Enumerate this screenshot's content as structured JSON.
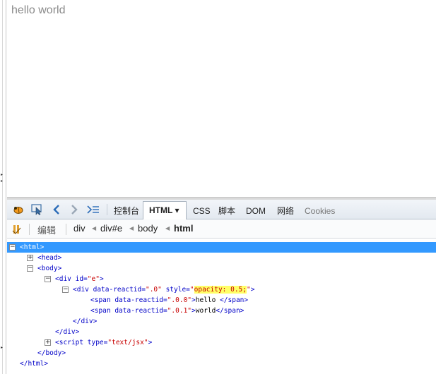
{
  "page": {
    "text": "hello world"
  },
  "toolbar": {
    "tabs": [
      {
        "label": "控制台"
      },
      {
        "label": "HTML"
      },
      {
        "label": "CSS"
      },
      {
        "label": "脚本"
      },
      {
        "label": "DOM"
      },
      {
        "label": "网络"
      },
      {
        "label": "Cookies"
      }
    ],
    "active_caret": "▾"
  },
  "breadcrumb": {
    "edit_label": "编辑",
    "items": [
      {
        "label": "div"
      },
      {
        "label": "div#e"
      },
      {
        "label": "body"
      },
      {
        "label": "html"
      }
    ]
  },
  "tree": {
    "html_open": "<html>",
    "head": "<head>",
    "body_open": "<body>",
    "div_e_tag": "<div",
    "div_e_attr": " id=",
    "div_e_val": "\"e\"",
    "div_e_close": ">",
    "div_inner_tag": "<div",
    "div_inner_attr1": " data-reactid=",
    "div_inner_val1": "\".0\"",
    "div_inner_attr2": " style=",
    "div_inner_q1": "\"",
    "div_inner_style": "opacity: 0.5;",
    "div_inner_q2": "\"",
    "div_inner_close": ">",
    "span1_tag": "<span",
    "span1_attr": " data-reactid=",
    "span1_val": "\".0.0\"",
    "span1_close": ">",
    "span1_text": "hello ",
    "span1_end": "</span>",
    "span2_tag": "<span",
    "span2_attr": " data-reactid=",
    "span2_val": "\".0.1\"",
    "span2_close": ">",
    "span2_text": "world",
    "span2_end": "</span>",
    "div_inner_end": "</div>",
    "div_e_end": "</div>",
    "script_tag": "<script",
    "script_attr": " type=",
    "script_val": "\"text/jsx\"",
    "script_close": ">",
    "body_close": "</body>",
    "html_close": "</html>"
  },
  "colors": {
    "selection": "#3399ff",
    "tag": "#0000c8",
    "value": "#c80000",
    "highlight": "#ffff66"
  }
}
